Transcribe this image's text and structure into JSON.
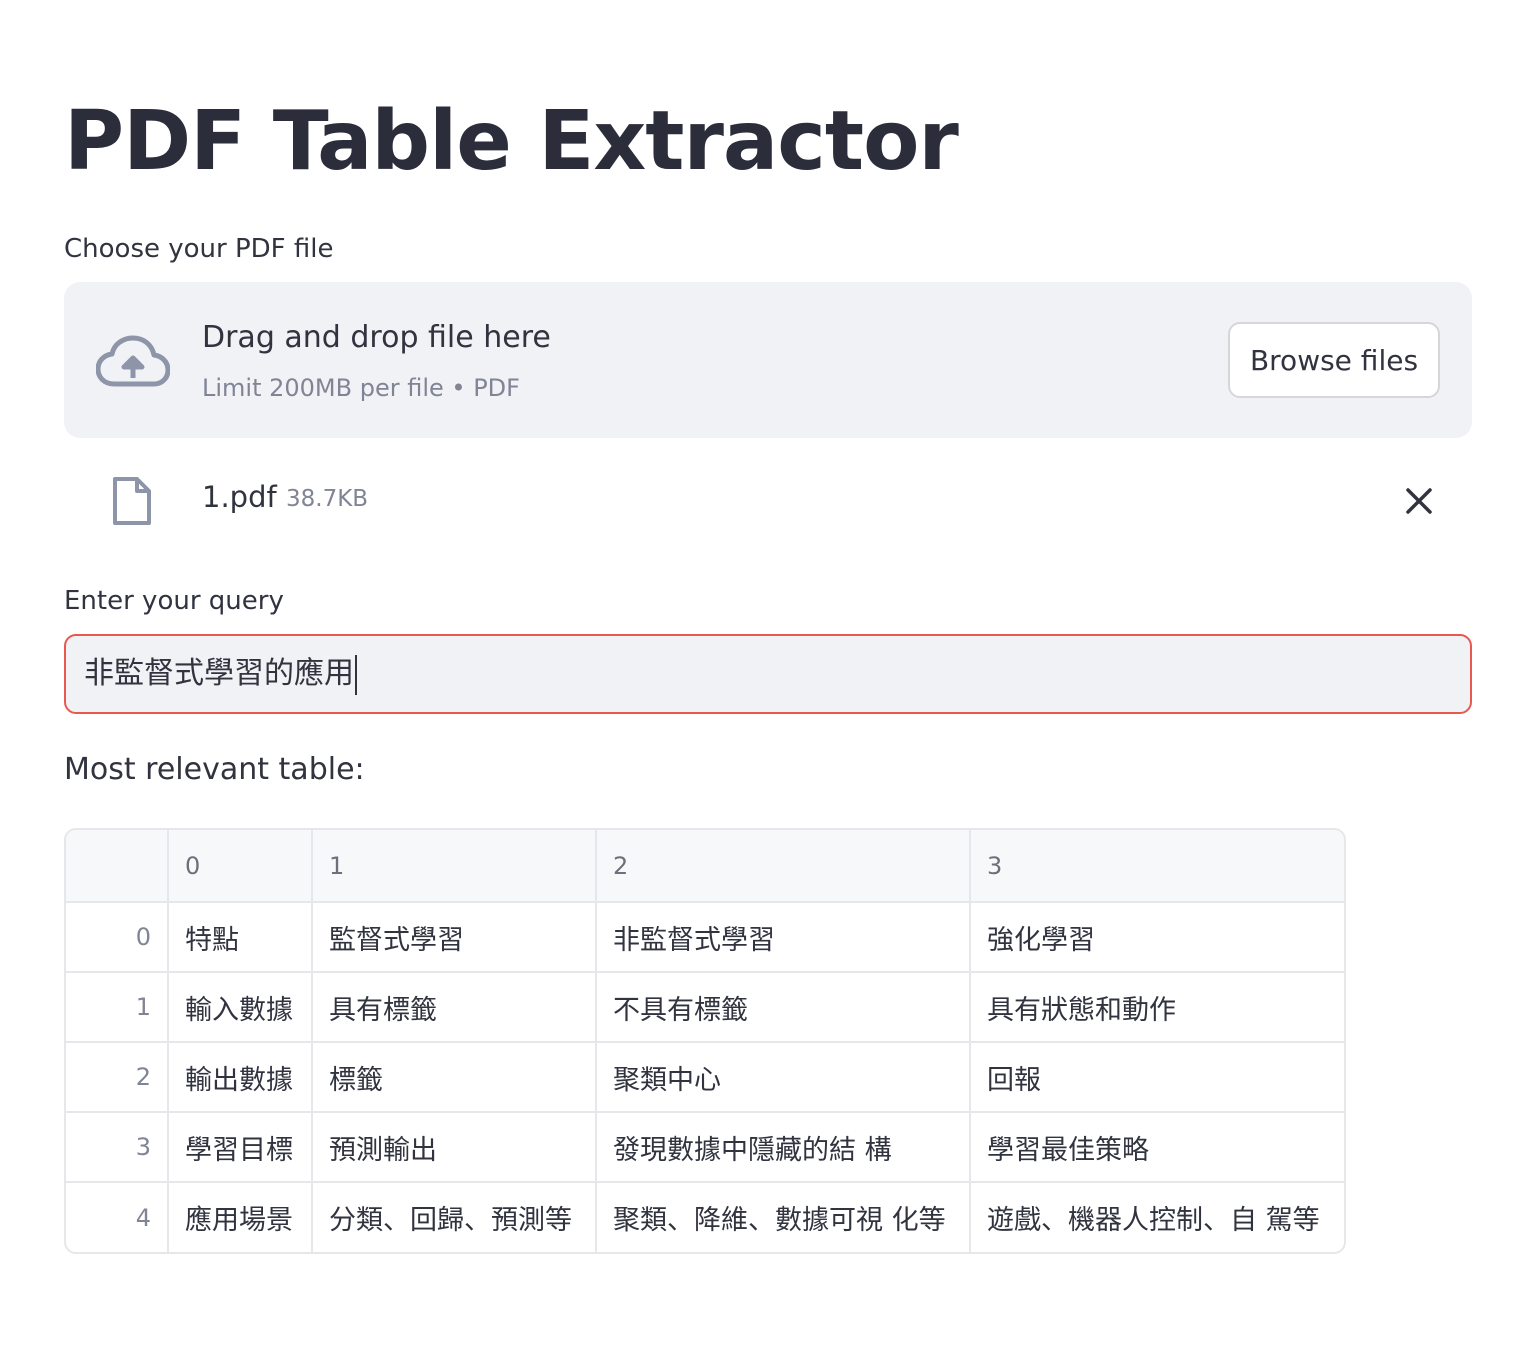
{
  "app": {
    "title": "PDF Table Extractor"
  },
  "uploader": {
    "label": "Choose your PDF file",
    "drop_title": "Drag and drop file here",
    "limit_text": "Limit 200MB per file • PDF",
    "browse_label": "Browse files"
  },
  "file": {
    "name": "1.pdf",
    "size": "38.7KB"
  },
  "query": {
    "label": "Enter your query",
    "value": "非監督式學習的應用"
  },
  "result": {
    "label": "Most relevant table:",
    "columns": [
      "0",
      "1",
      "2",
      "3"
    ],
    "rows": [
      {
        "index": "0",
        "cells": [
          "特點",
          "監督式學習",
          "非監督式學習",
          "強化學習"
        ]
      },
      {
        "index": "1",
        "cells": [
          "輸入數據",
          "具有標籤",
          "不具有標籤",
          "具有狀態和動作"
        ]
      },
      {
        "index": "2",
        "cells": [
          "輸出數據",
          "標籤",
          "聚類中心",
          "回報"
        ]
      },
      {
        "index": "3",
        "cells": [
          "學習目標",
          "預測輸出",
          "發現數據中隱藏的結 構",
          "學習最佳策略"
        ]
      },
      {
        "index": "4",
        "cells": [
          "應用場景",
          "分類、回歸、預測等",
          "聚類、降維、數據可視 化等",
          "遊戲、機器人控制、自 駕等"
        ]
      }
    ]
  },
  "icons": {
    "upload": "cloud-upload-icon",
    "file": "file-icon",
    "close": "close-icon"
  },
  "colors": {
    "dropzone_bg": "#f0f2f6",
    "input_border_focus": "#e8584f",
    "text": "#31333f",
    "muted": "#808495"
  }
}
